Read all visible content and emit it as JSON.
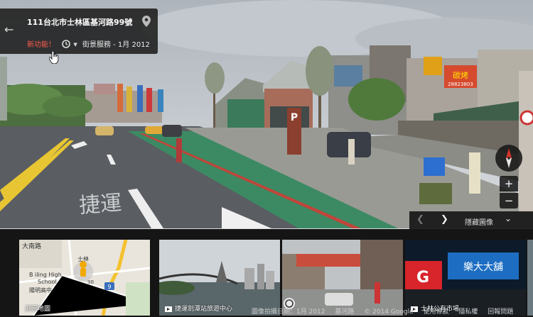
{
  "header": {
    "address": "111台北市士林區基河路99號",
    "new_feature": "新功能！",
    "date_label": "街景服務 - 1月 2012",
    "icons": [
      "back-arrow-icon",
      "location-pin-icon",
      "clock-icon",
      "chevron-down-icon",
      "hand-cursor-icon"
    ]
  },
  "scene": {
    "road_marking": "捷運",
    "store_sign": "碳烤",
    "store_sign_number": "28823803",
    "parking_sign": "P",
    "icons": [
      "compass-icon",
      "zoom-in-icon",
      "zoom-out-icon"
    ]
  },
  "strip_nav": {
    "hide_label": "隱藏圖像",
    "icons": [
      "chevron-left-icon",
      "chevron-right-icon",
      "chevron-double-down-icon"
    ]
  },
  "thumbnails": [
    {
      "label": "返回地圖",
      "icon": "",
      "map_labels": {
        "dalongdong": "大南路",
        "school_en_1": "B iling High",
        "school_en_2": "School",
        "school_zh": "陽明高中",
        "mrt": "士林",
        "route": "9",
        "poi": "9B"
      }
    },
    {
      "label": "捷運劍潭站旅遊中心",
      "icon": "video-icon"
    },
    {
      "label": "",
      "icon": "panorama-icon"
    },
    {
      "label": "士林公有市場",
      "icon": "video-icon",
      "sign_1": "G",
      "sign_2": "樂大大舖"
    }
  ],
  "footer": {
    "capture_date": "圖像拍攝日期：1月 2012",
    "location": "基河路",
    "copyright": "© 2014 Google",
    "terms": "使用條款",
    "privacy": "隱私權",
    "report": "回報問題"
  },
  "colors": {
    "sky": "#c9cfd5",
    "road": "#5a5d62",
    "bikelane": "#3c8a63",
    "sidewalk": "#9a9a94",
    "new_feature": "#ff5d4e",
    "compass_red": "#d9342b",
    "strip_bg": "#151515"
  }
}
